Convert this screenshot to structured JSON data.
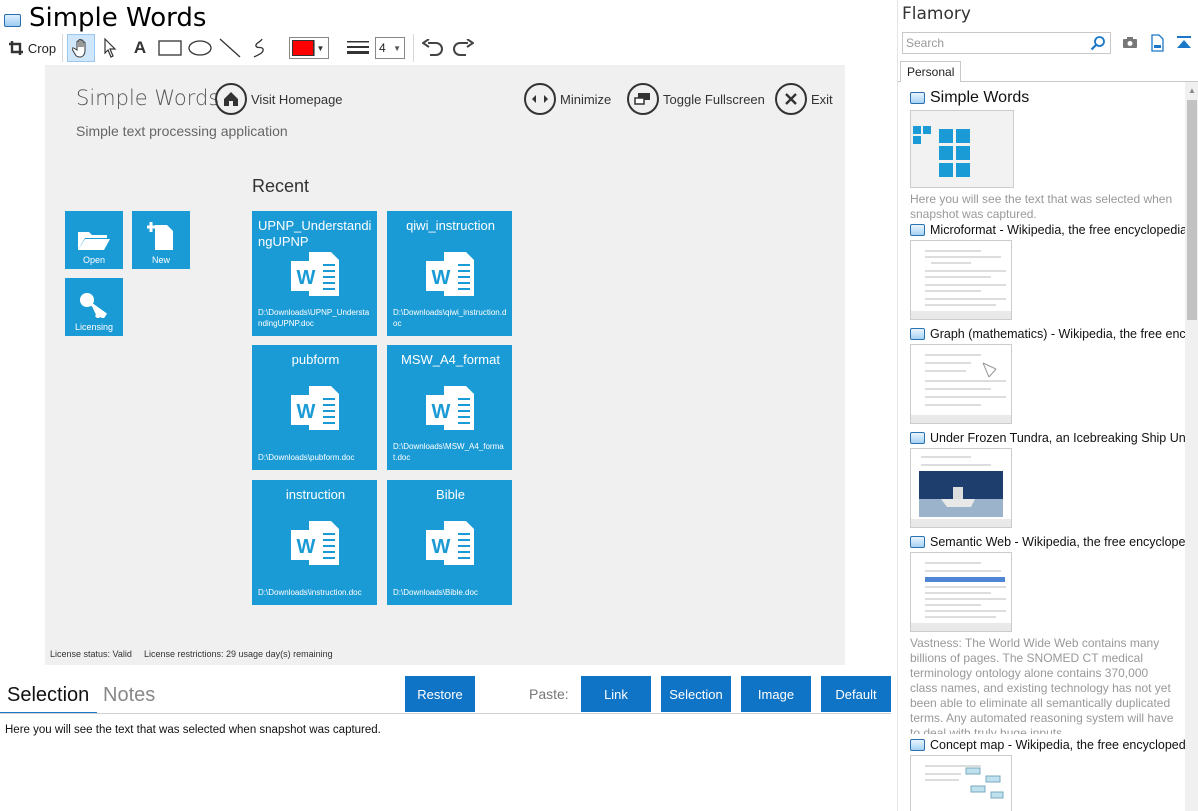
{
  "window": {
    "title": "Simple Words"
  },
  "toolbar": {
    "crop_label": "Crop",
    "line_width": "4",
    "pen_color": "#ff0000"
  },
  "snapshot": {
    "app_title": "Simple Words",
    "subtitle": "Simple text processing application",
    "nav": {
      "visit_homepage": "Visit Homepage",
      "minimize": "Minimize",
      "toggle_fullscreen": "Toggle Fullscreen",
      "exit": "Exit"
    },
    "actions": {
      "open": "Open",
      "new": "New",
      "licensing": "Licensing"
    },
    "recent_title": "Recent",
    "recent": [
      {
        "title": "UPNP_UnderstandingUPNP",
        "path": "D:\\Downloads\\UPNP_UnderstandingUPNP.doc"
      },
      {
        "title": "qiwi_instruction",
        "path": "D:\\Downloads\\qiwi_instruction.doc"
      },
      {
        "title": "pubform",
        "path": "D:\\Downloads\\pubform.doc"
      },
      {
        "title": "MSW_A4_format",
        "path": "D:\\Downloads\\MSW_A4_format.doc"
      },
      {
        "title": "instruction",
        "path": "D:\\Downloads\\instruction.doc"
      },
      {
        "title": "Bible",
        "path": "D:\\Downloads\\Bible.doc"
      }
    ],
    "license_status": "License status: Valid",
    "license_restrictions": "License restrictions: 29 usage day(s) remaining",
    "tile_color": "#1b9bd6"
  },
  "bottom": {
    "tab_selection": "Selection",
    "tab_notes": "Notes",
    "restore": "Restore",
    "paste_label": "Paste:",
    "paste_link": "Link",
    "paste_selection": "Selection",
    "paste_image": "Image",
    "paste_default": "Default",
    "selection_text": "Here you will see the text that was selected when snapshot was captured.",
    "button_color": "#0f73c6"
  },
  "flamory": {
    "title": "Flamory",
    "search_placeholder": "Search",
    "tab_personal": "Personal",
    "items": [
      {
        "title": "Simple Words",
        "desc": "Here you will see the text that was selected when snapshot was captured."
      },
      {
        "title": "Microformat - Wikipedia, the free encyclopedia",
        "desc": ""
      },
      {
        "title": "Graph (mathematics) - Wikipedia, the free ency",
        "desc": ""
      },
      {
        "title": "Under Frozen Tundra, an Icebreaking Ship Unco",
        "desc": ""
      },
      {
        "title": "Semantic Web - Wikipedia, the free encycloped",
        "desc": "Vastness: The World Wide Web contains many billions of pages. The SNOMED CT medical terminology ontology alone contains 370,000 class names, and existing technology has not yet been able to eliminate all semantically duplicated terms. Any automated reasoning system will have to deal with truly huge inputs."
      },
      {
        "title": "Concept map - Wikipedia, the free encyclopedi",
        "desc": ""
      }
    ]
  }
}
